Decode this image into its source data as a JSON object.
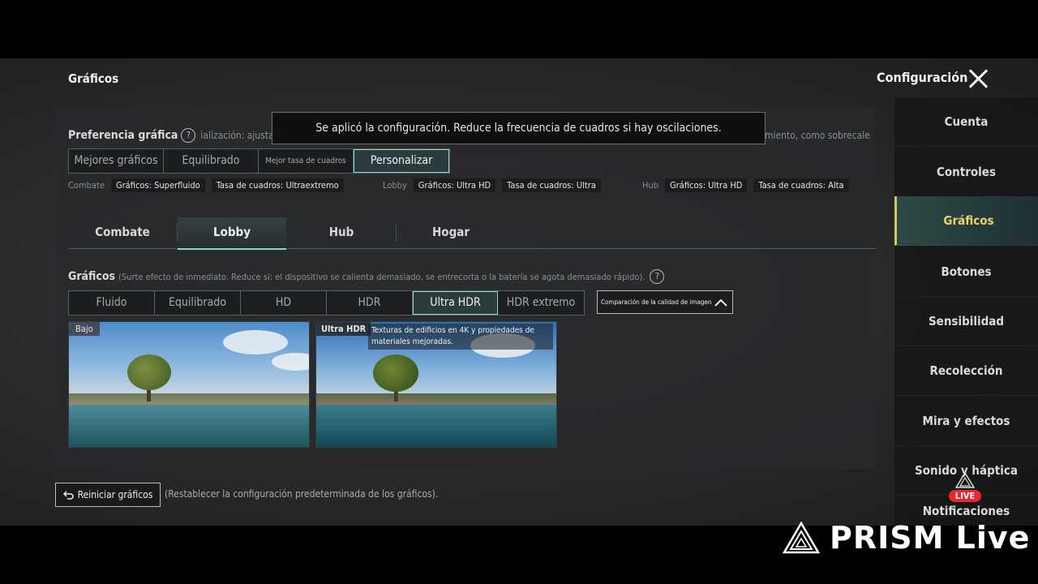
{
  "header": {
    "title": "Gráficos",
    "config": "Configuración"
  },
  "toast": "Se aplicó la configuración. Reduce la frecuencia de cuadros si hay oscilaciones.",
  "preference": {
    "label": "Preferencia gráfica",
    "desc_left": "ialización: ajusta la",
    "desc_right": "miento, como sobrecale",
    "options": [
      "Mejores gráficos",
      "Equilibrado",
      "Mejor tasa de cuadros",
      "Personalizar"
    ],
    "selected": "Personalizar"
  },
  "presets": [
    {
      "name": "Combate",
      "graphics": "Gráficos: Superfluido",
      "fps": "Tasa de cuadros: Ultraextremo"
    },
    {
      "name": "Lobby",
      "graphics": "Gráficos: Ultra HD",
      "fps": "Tasa de cuadros: Ultra"
    },
    {
      "name": "Hub",
      "graphics": "Gráficos: Ultra HD",
      "fps": "Tasa de cuadros: Alta"
    }
  ],
  "tabs": [
    "Combate",
    "Lobby",
    "Hub",
    "Hogar"
  ],
  "active_tab": "Lobby",
  "graphics": {
    "label": "Gráficos",
    "note": "(Surte efecto de inmediato. Reduce si: el dispositivo se calienta demasiado, se entrecorta o la batería se agota demasiado rápido).",
    "options": [
      "Fluido",
      "Equilibrado",
      "HD",
      "HDR",
      "Ultra HDR",
      "HDR extremo"
    ],
    "selected": "Ultra HDR",
    "compare_label": "Comparación de la calidad de imagen"
  },
  "images": {
    "left_label": "Bajo",
    "right_label": "Ultra HDR",
    "right_desc": "Texturas de edificios en 4K y propiedades de materiales mejoradas."
  },
  "reset": {
    "button": "Reiniciar gráficos",
    "desc": "(Restablecer la configuración predeterminada de los gráficos)."
  },
  "sidebar": {
    "items": [
      "Cuenta",
      "Controles",
      "Gráficos",
      "Botones",
      "Sensibilidad",
      "Recolección",
      "Mira y efectos",
      "Sonido y háptica",
      "Notificaciones"
    ],
    "active": "Gráficos"
  },
  "overlay": {
    "live_badge": "LIVE",
    "brand": "PRISM Live"
  },
  "colors": {
    "accent_teal": "#8fd8d1",
    "active_gold": "#e9d36b",
    "live_red": "#e8262d"
  }
}
